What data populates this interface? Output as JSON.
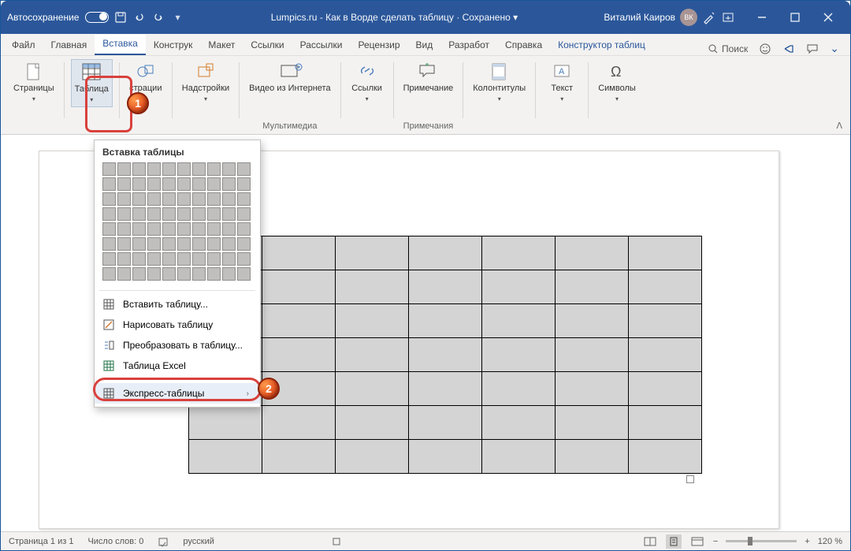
{
  "titlebar": {
    "autosave": "Автосохранение",
    "doc_title": "Lumpics.ru - Как в Ворде сделать таблицу",
    "saved_label": "Сохранено",
    "user": "Виталий Каиров",
    "avatar_initials": "ВК"
  },
  "tabs": {
    "file": "Файл",
    "home": "Главная",
    "insert": "Вставка",
    "design": "Конструк",
    "layout": "Макет",
    "references": "Ссылки",
    "mailings": "Рассылки",
    "review": "Рецензир",
    "view": "Вид",
    "developer": "Разработ",
    "help": "Справка",
    "table_design": "Конструктор таблиц",
    "search": "Поиск"
  },
  "ribbon": {
    "pages": "Страницы",
    "table": "Таблица",
    "illustrations": "стрaции",
    "addins": "Надстройки",
    "video": "Видео из Интернета",
    "multimedia": "Мультимедиа",
    "links": "Ссылки",
    "comment": "Примечание",
    "comments": "Примечания",
    "header_footer": "Колонтитулы",
    "text": "Текст",
    "symbols": "Символы"
  },
  "dropdown": {
    "title": "Вставка таблицы",
    "insert_table": "Вставить таблицу...",
    "draw_table": "Нарисовать таблицу",
    "convert": "Преобразовать в таблицу...",
    "excel": "Таблица Excel",
    "quick": "Экспресс-таблицы"
  },
  "grid": {
    "rows": 8,
    "cols": 10
  },
  "doc_table": {
    "rows": 7,
    "cols": 7
  },
  "statusbar": {
    "page": "Страница 1 из 1",
    "words": "Число слов: 0",
    "lang": "русский",
    "zoom": "120 %"
  },
  "markers": {
    "one": "1",
    "two": "2"
  }
}
